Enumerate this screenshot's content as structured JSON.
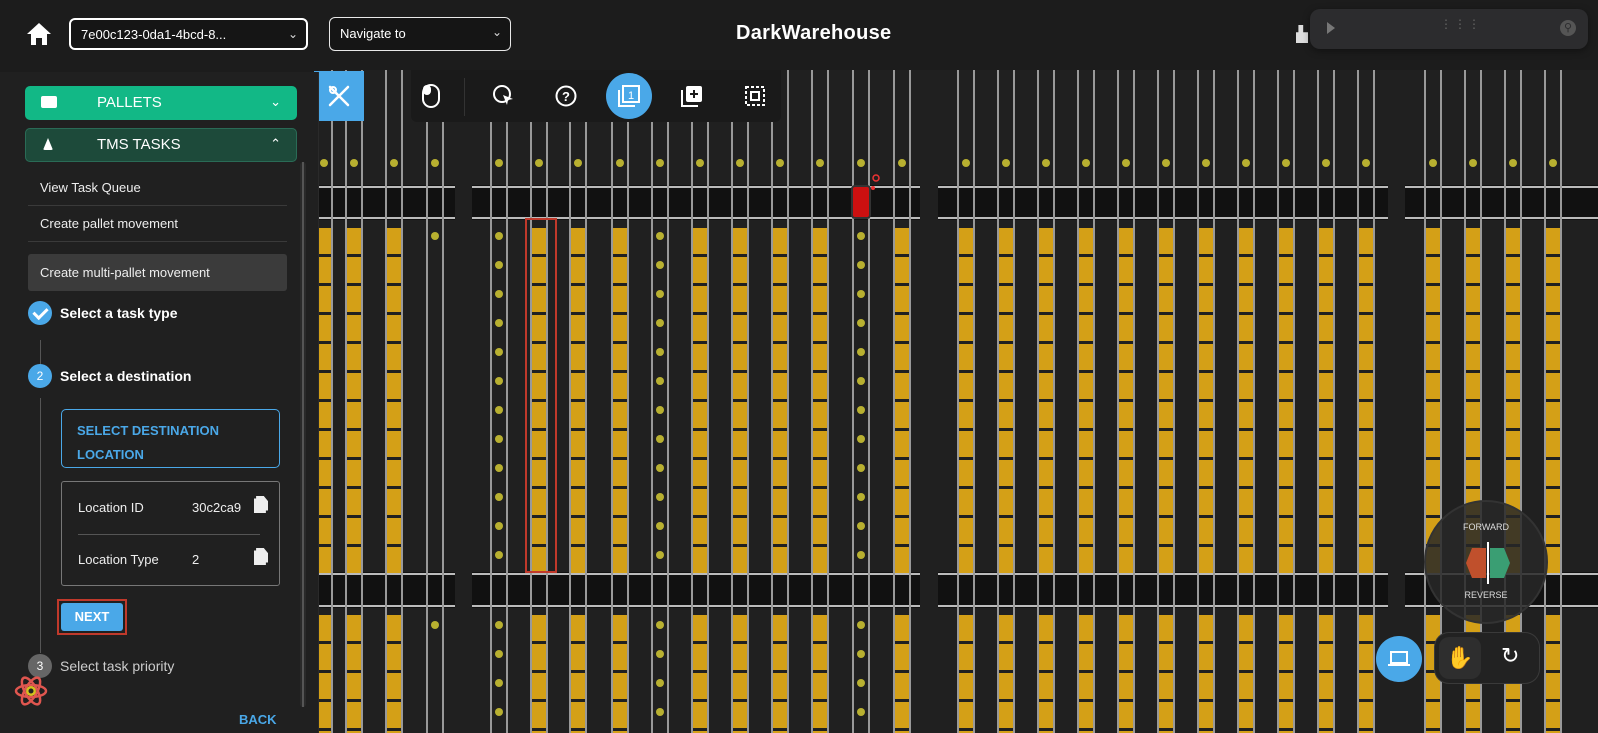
{
  "header": {
    "robot_select": "7e00c123-0da1-4bcd-8...",
    "navigate_select": "Navigate to",
    "brand": "DarkWarehouse"
  },
  "sidebar": {
    "accordions": [
      {
        "label": "PALLETS",
        "expanded": false
      },
      {
        "label": "TMS TASKS",
        "expanded": true
      }
    ],
    "menu": [
      "View Task Queue",
      "Create pallet movement",
      "Create multi-pallet movement"
    ],
    "active_menu_index": 2,
    "steps": [
      {
        "number": "",
        "label": "Select a task type",
        "state": "done"
      },
      {
        "number": "2",
        "label": "Select a destination",
        "state": "active"
      },
      {
        "number": "3",
        "label": "Select task priority",
        "state": "pending"
      }
    ],
    "destination_button": "SELECT DESTINATION LOCATION",
    "location": {
      "id_label": "Location ID",
      "id_value": "30c2ca9",
      "type_label": "Location Type",
      "type_value": "2"
    },
    "next": "NEXT",
    "back": "BACK"
  },
  "toolbar": {
    "icons": [
      "mouse-icon",
      "cursor-target-icon",
      "help-icon",
      "single-select-icon",
      "add-select-icon",
      "box-select-icon"
    ],
    "active_index": 3
  },
  "compass": {
    "forward": "FORWARD",
    "reverse": "REVERSE"
  },
  "colors": {
    "accent": "#4aa8e8",
    "green": "#12b886",
    "teal": "#1d4a3a",
    "pallet": "#d4a017",
    "highlight": "#c0392b",
    "robot": "#cc1010"
  }
}
